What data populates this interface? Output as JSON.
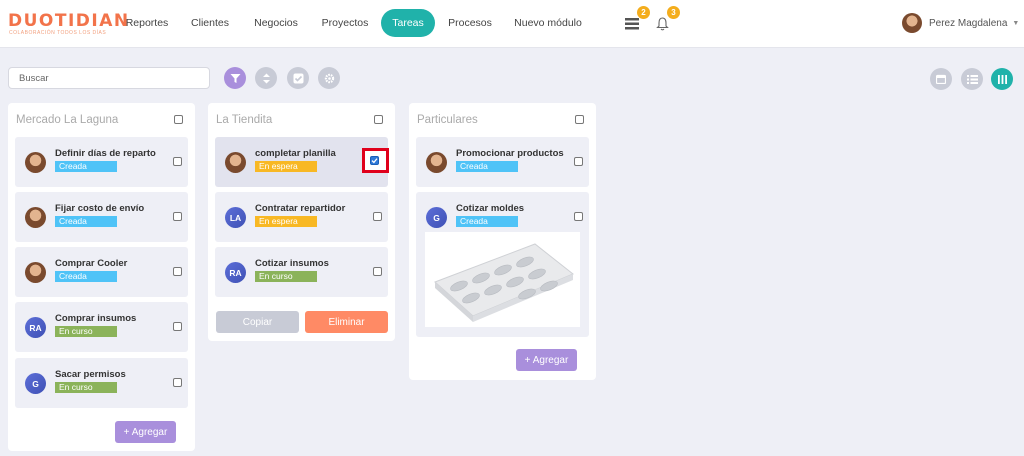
{
  "header": {
    "logo": {
      "main": "DUOTIDIAN",
      "tagline": "COLABORACIÓN TODOS LOS DÍAS"
    },
    "nav": [
      {
        "label": "Reportes",
        "active": false
      },
      {
        "label": "Clientes",
        "active": false
      },
      {
        "label": "Negocios",
        "active": false
      },
      {
        "label": "Proyectos",
        "active": false
      },
      {
        "label": "Tareas",
        "active": true
      },
      {
        "label": "Procesos",
        "active": false
      },
      {
        "label": "Nuevo módulo",
        "active": false
      }
    ],
    "list_icon_badge": "2",
    "bell_icon_badge": "3",
    "user_name": "Perez Magdalena"
  },
  "toolbar": {
    "search_placeholder": "Buscar",
    "icons": [
      "filter-icon",
      "sort-icon",
      "check-icon",
      "gear-icon"
    ],
    "view_icons": [
      "calendar-icon",
      "list-view-icon",
      "board-view-icon"
    ]
  },
  "colors": {
    "accent": "#20b2aa",
    "purple": "#a98fdc",
    "creada": "#4fc3f7",
    "en_espera": "#f8b824",
    "en_curso": "#8bb35a",
    "eliminar": "#ff8a65",
    "copiar": "#c8cbd6"
  },
  "columns": [
    {
      "title": "Mercado La Laguna",
      "add_label": "+ Agregar",
      "cards": [
        {
          "title": "Definir días de reparto",
          "status": "Creada",
          "avatar": "photo",
          "checked": false
        },
        {
          "title": "Fijar costo de envío",
          "status": "Creada",
          "avatar": "photo",
          "checked": false
        },
        {
          "title": "Comprar Cooler",
          "status": "Creada",
          "avatar": "photo",
          "checked": false
        },
        {
          "title": "Comprar insumos",
          "status": "En curso",
          "avatar": "RA",
          "checked": false
        },
        {
          "title": "Sacar permisos",
          "status": "En curso",
          "avatar": "G",
          "checked": false
        }
      ]
    },
    {
      "title": "La Tiendita",
      "copy_label": "Copiar",
      "delete_label": "Eliminar",
      "cards": [
        {
          "title": "completar planilla",
          "status": "En espera",
          "avatar": "photo",
          "checked": true
        },
        {
          "title": "Contratar repartidor",
          "status": "En espera",
          "avatar": "LA",
          "checked": false
        },
        {
          "title": "Cotizar insumos",
          "status": "En curso",
          "avatar": "RA",
          "checked": false
        }
      ]
    },
    {
      "title": "Particulares",
      "add_label": "+ Agregar",
      "cards": [
        {
          "title": "Promocionar productos",
          "status": "Creada",
          "avatar": "photo",
          "checked": false
        },
        {
          "title": "Cotizar moldes",
          "status": "Creada",
          "avatar": "G",
          "checked": false,
          "has_image": true
        }
      ]
    }
  ]
}
